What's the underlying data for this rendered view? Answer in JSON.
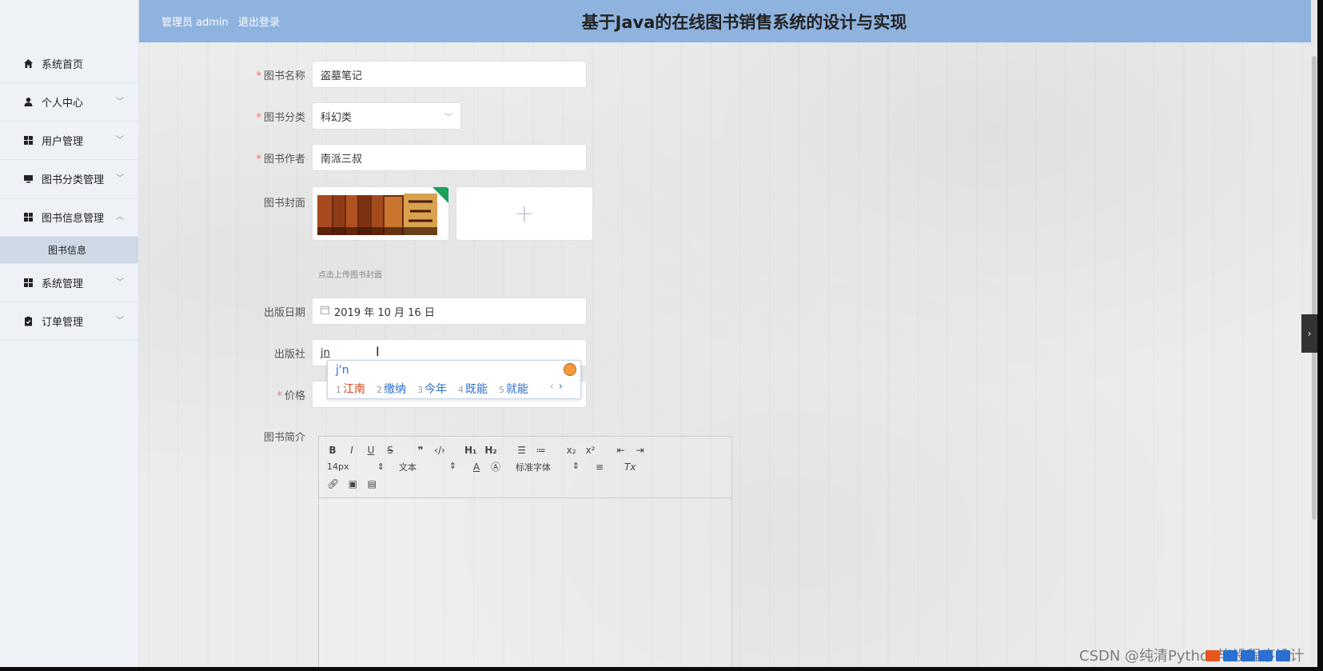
{
  "header": {
    "admin_label": "管理员 admin",
    "logout_label": "退出登录",
    "title": "基于Java的在线图书销售系统的设计与实现"
  },
  "sidebar": {
    "items": [
      {
        "label": "系统首页",
        "icon": "home-icon"
      },
      {
        "label": "个人中心",
        "icon": "user-icon",
        "expandable": true
      },
      {
        "label": "用户管理",
        "icon": "grid-icon",
        "expandable": true
      },
      {
        "label": "图书分类管理",
        "icon": "monitor-icon",
        "expandable": true
      },
      {
        "label": "图书信息管理",
        "icon": "grid-icon",
        "expandable": true,
        "expanded": true
      },
      {
        "label": "系统管理",
        "icon": "grid-icon",
        "expandable": true
      },
      {
        "label": "订单管理",
        "icon": "clipboard-icon",
        "expandable": true
      }
    ],
    "sub_item": "图书信息"
  },
  "form": {
    "book_name": {
      "label": "图书名称",
      "value": "盗墓笔记"
    },
    "book_category": {
      "label": "图书分类",
      "value": "科幻类"
    },
    "book_author": {
      "label": "图书作者",
      "value": "南派三叔"
    },
    "book_cover": {
      "label": "图书封面",
      "hint": "点击上传图书封面"
    },
    "publish_date": {
      "label": "出版日期",
      "value": "2019 年 10 月 16 日"
    },
    "publisher": {
      "label": "出版社",
      "value": "jn"
    },
    "price": {
      "label": "价格"
    },
    "intro": {
      "label": "图书简介"
    }
  },
  "ime": {
    "pinyin": "j'n",
    "candidates": [
      {
        "num": "1",
        "text": "江南"
      },
      {
        "num": "2",
        "text": "缴纳"
      },
      {
        "num": "3",
        "text": "今年"
      },
      {
        "num": "4",
        "text": "既能"
      },
      {
        "num": "5",
        "text": "就能"
      }
    ]
  },
  "editor": {
    "font_size": "14px",
    "text_type": "文本",
    "font_family": "标准字体"
  },
  "watermark": "CSDN @纯清Python毕设程序设计",
  "colors": {
    "header_bg": "#8fb3df",
    "sidebar_bg": "#eef1f6",
    "required": "#f56c6c",
    "ime_blue": "#2a6fd1"
  }
}
